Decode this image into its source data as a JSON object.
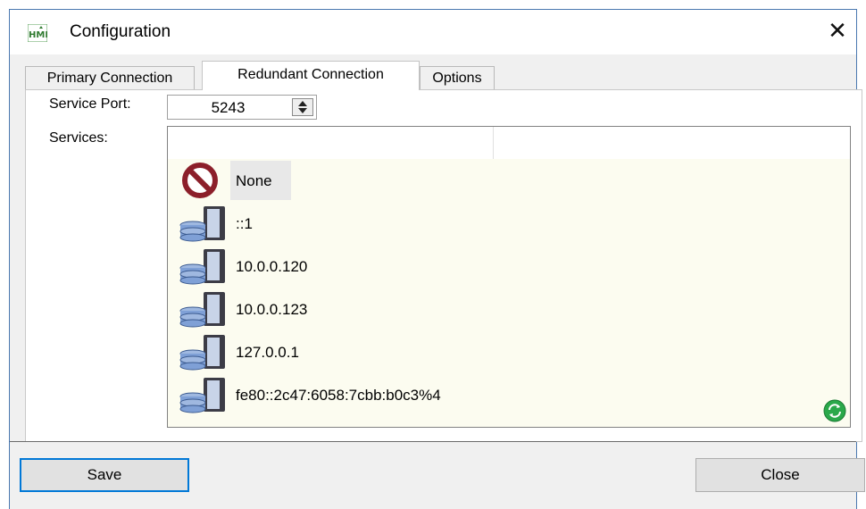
{
  "window": {
    "title": "Configuration"
  },
  "tabs": [
    {
      "label": "Primary Connection"
    },
    {
      "label": "Redundant Connection"
    },
    {
      "label": "Options"
    }
  ],
  "service_port": {
    "label": "Service Port:",
    "value": "5243"
  },
  "services": {
    "label": "Services:",
    "items": [
      {
        "label": "None",
        "icon": "no-entry-icon"
      },
      {
        "label": "::1",
        "icon": "server-database-icon"
      },
      {
        "label": "10.0.0.120",
        "icon": "server-database-icon"
      },
      {
        "label": "10.0.0.123",
        "icon": "server-database-icon"
      },
      {
        "label": "127.0.0.1",
        "icon": "server-database-icon"
      },
      {
        "label": "fe80::2c47:6058:7cbb:b0c3%4",
        "icon": "server-database-icon"
      }
    ]
  },
  "buttons": {
    "save": "Save",
    "close": "Close"
  },
  "colors": {
    "accent": "#0078d7",
    "list_bg": "#fcfcf0",
    "refresh_green": "#2aa84a"
  }
}
